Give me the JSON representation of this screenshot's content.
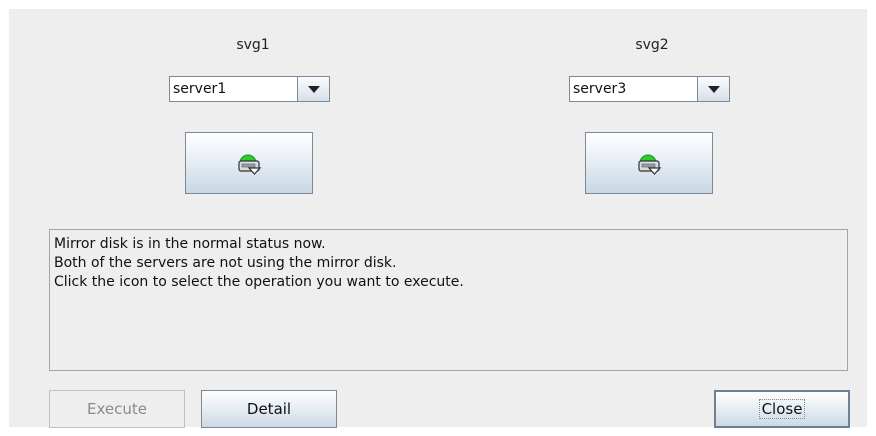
{
  "servers": [
    {
      "group_label": "svg1",
      "selected": "server1",
      "icon": "mirror-disk-normal-icon"
    },
    {
      "group_label": "svg2",
      "selected": "server3",
      "icon": "mirror-disk-normal-icon"
    }
  ],
  "message": {
    "lines": [
      "Mirror disk is in the normal status now.",
      "Both of the servers are not using the mirror disk.",
      "Click the icon to select the operation you want to execute."
    ]
  },
  "buttons": {
    "execute": "Execute",
    "detail": "Detail",
    "close": "Close"
  },
  "colors": {
    "status_normal": "#2ecc2e",
    "panel_background": "#eeeeee"
  }
}
